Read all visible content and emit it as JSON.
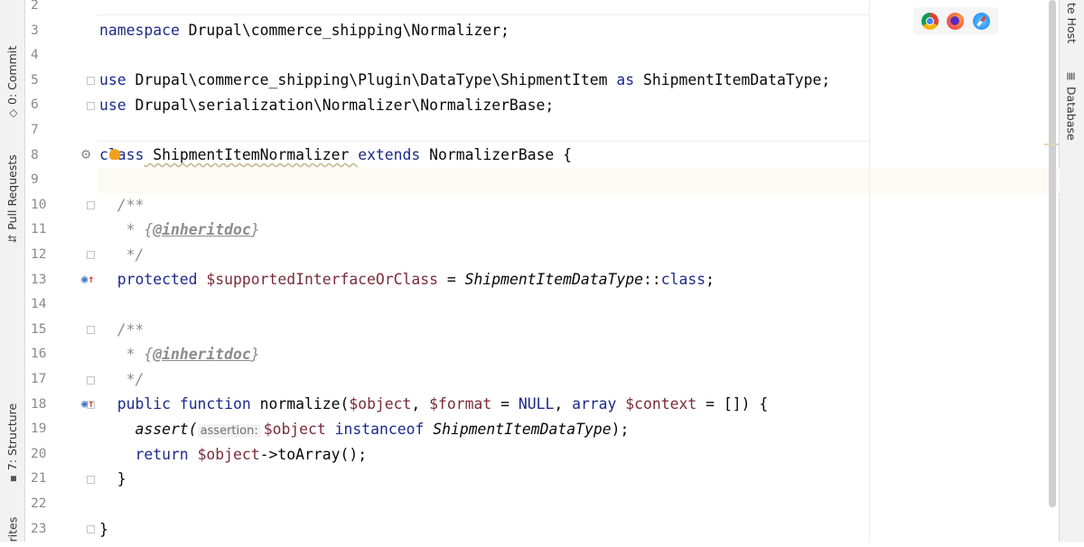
{
  "left_tool_windows": [
    {
      "label": "0: Commit",
      "icon": "commit-icon"
    },
    {
      "label": "Pull Requests",
      "icon": "pull-request-icon"
    },
    {
      "label": "7: Structure",
      "icon": "structure-icon"
    },
    {
      "label": "rites",
      "icon": "favorites-icon"
    }
  ],
  "right_tool_windows": [
    {
      "label": "te Host",
      "icon": "remote-host-icon"
    },
    {
      "label": "Database",
      "icon": "database-icon"
    }
  ],
  "browser_icons": [
    "chrome-icon",
    "firefox-icon",
    "safari-icon"
  ],
  "line_numbers": [
    "2",
    "3",
    "4",
    "5",
    "6",
    "7",
    "8",
    "9",
    "10",
    "11",
    "12",
    "13",
    "14",
    "15",
    "16",
    "17",
    "18",
    "19",
    "20",
    "21",
    "22",
    "23"
  ],
  "code": {
    "l3_kw": "namespace",
    "l3_rest": " Drupal\\commerce_shipping\\Normalizer;",
    "l5_kw": "use",
    "l5_a": " Drupal\\commerce_shipping\\Plugin\\DataType\\ShipmentItem ",
    "l5_as": "as",
    "l5_b": " ShipmentItemDataType;",
    "l6_kw": "use",
    "l6_rest": " Drupal\\serialization\\Normalizer\\NormalizerBase;",
    "l8_c": "c",
    "l8_lass": "lass",
    "l8_name": " ShipmentItemNormalizer ",
    "l8_extends": "extends",
    "l8_rest": " NormalizerBase {",
    "l10": "  /**",
    "l11_star": "   * ",
    "l11_open": "{",
    "l11_tag": "@inheritdoc",
    "l11_close": "}",
    "l12": "   */",
    "l13_kw": "  protected",
    "l13_var": " $supportedInterfaceOrClass",
    "l13_eq": " = ",
    "l13_type": "ShipmentItemDataType",
    "l13_sep": "::",
    "l13_class": "class",
    "l13_end": ";",
    "l15": "  /**",
    "l16_star": "   * ",
    "l16_open": "{",
    "l16_tag": "@inheritdoc",
    "l16_close": "}",
    "l17": "   */",
    "l18_kw1": "  public",
    "l18_kw2": " function",
    "l18_name": " normalize(",
    "l18_v1": "$object",
    "l18_c1": ", ",
    "l18_v2": "$format",
    "l18_eq": " = ",
    "l18_null": "NULL",
    "l18_c2": ", ",
    "l18_array": "array",
    "l18_sp": " ",
    "l18_v3": "$context",
    "l18_end": " = []) {",
    "l19_fn": "    assert(",
    "l19_hint": "assertion:",
    "l19_v": "$object",
    "l19_sp": " ",
    "l19_kw": "instanceof",
    "l19_sp2": " ",
    "l19_type": "ShipmentItemDataType",
    "l19_end": ");",
    "l20_kw": "    return",
    "l20_sp": " ",
    "l20_v": "$object",
    "l20_rest": "->toArray();",
    "l21": "  }",
    "l23": "}"
  }
}
